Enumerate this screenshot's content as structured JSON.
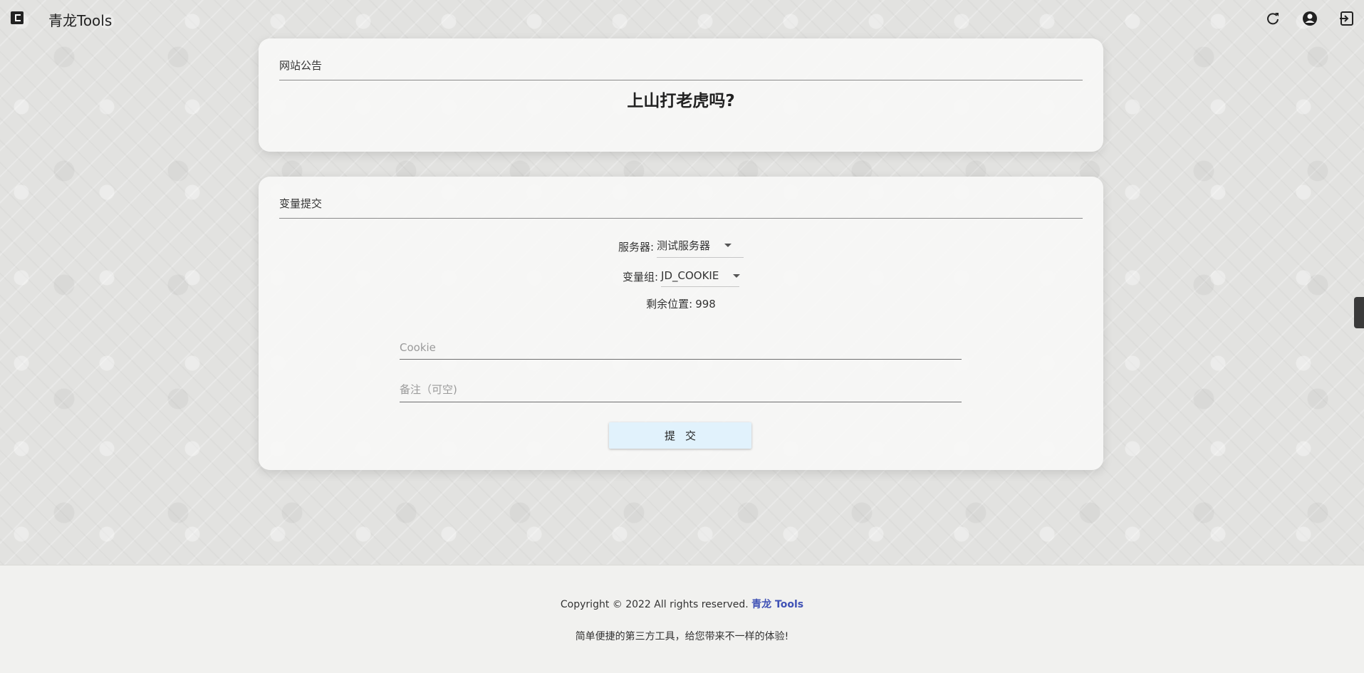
{
  "app": {
    "title": "青龙Tools"
  },
  "topbar": {
    "icons": [
      "menu-icon",
      "refresh-icon",
      "account-icon",
      "logout-icon"
    ]
  },
  "notice_card": {
    "header": "网站公告",
    "content": "上山打老虎吗?"
  },
  "submit_card": {
    "header": "变量提交",
    "server_label": "服务器:",
    "server_value": "测试服务器",
    "group_label": "变量组:",
    "group_value": "JD_COOKIE",
    "remaining_label": "剩余位置:",
    "remaining_value": "998",
    "cookie_placeholder": "Cookie",
    "remark_placeholder": "备注（可空)",
    "submit_label": "提交"
  },
  "footer": {
    "copyright": "Copyright © 2022 All rights reserved.",
    "brand": "青龙 Tools",
    "slogan": "简单便捷的第三方工具，给您带来不一样的体验!"
  },
  "colors": {
    "brand_link": "#3f51b5",
    "submit_bg": "#e1f2fc",
    "card_bg": "#f7f7f6"
  }
}
